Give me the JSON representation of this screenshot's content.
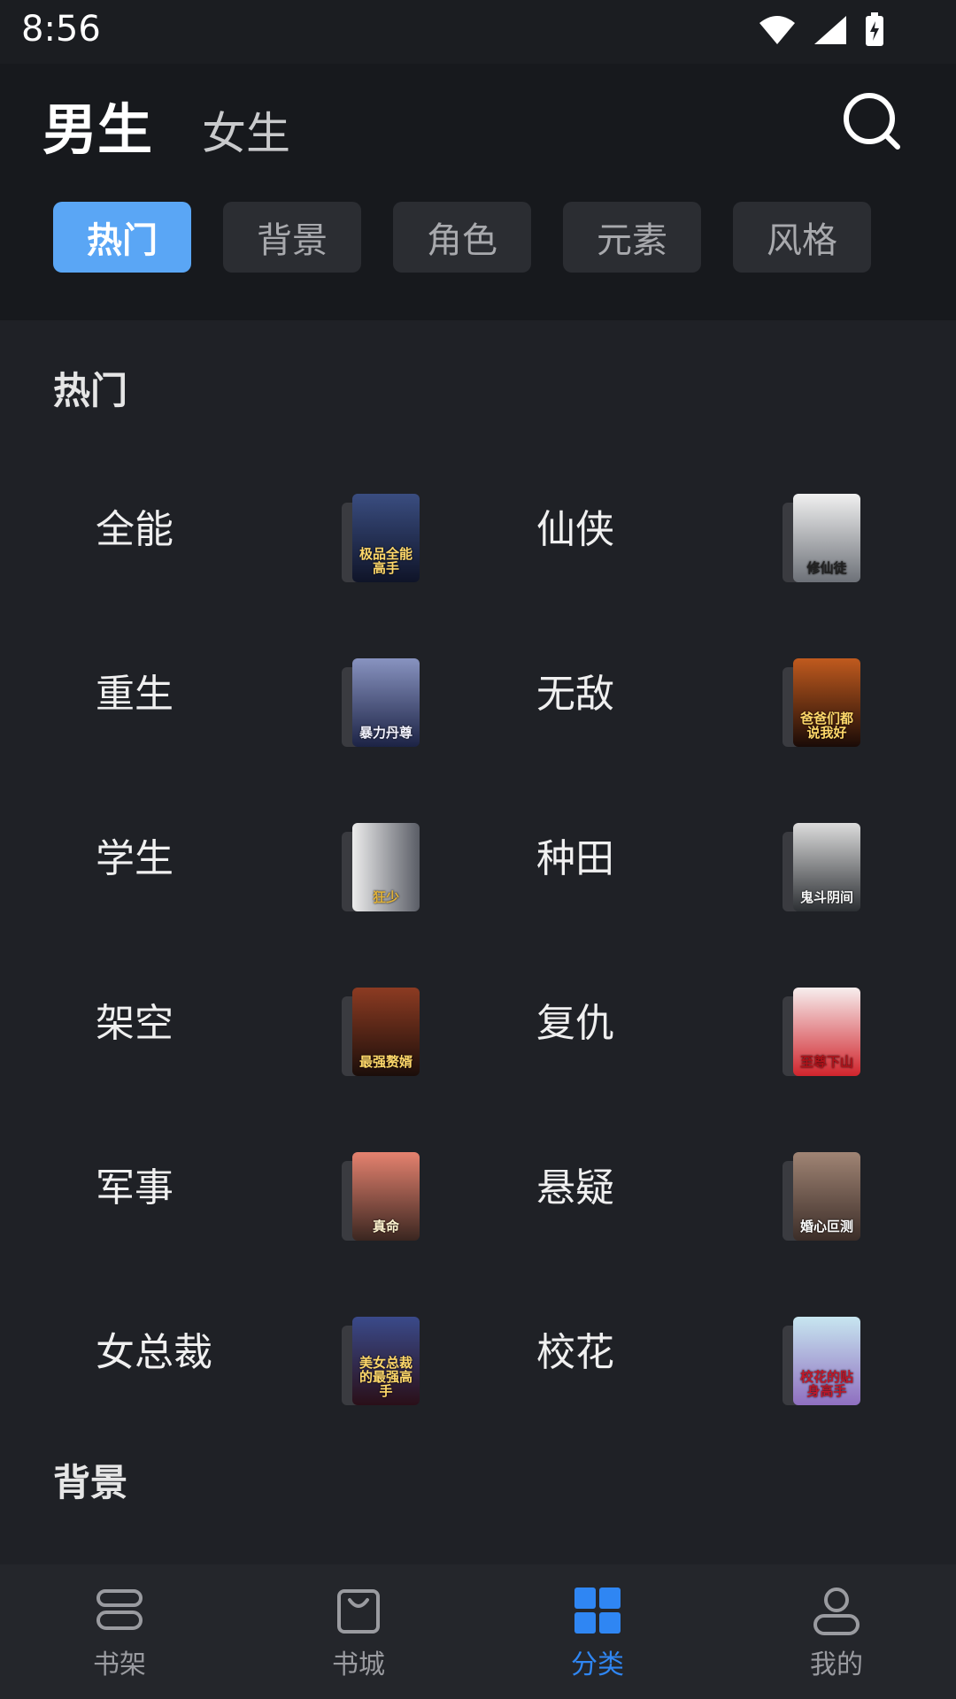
{
  "status": {
    "time": "8:56"
  },
  "header": {
    "gender_active": "男生",
    "gender_inactive": "女生"
  },
  "filters": [
    "热门",
    "背景",
    "角色",
    "元素",
    "风格"
  ],
  "sections": [
    {
      "title": "热门",
      "items": [
        {
          "label": "全能",
          "cover_text": "极品全能高手",
          "cover_color": "#1f2a4a"
        },
        {
          "label": "仙侠",
          "cover_text": "修仙徒",
          "cover_color": "#d8dadd"
        },
        {
          "label": "重生",
          "cover_text": "暴力丹尊",
          "cover_color": "#2c3560"
        },
        {
          "label": "无敌",
          "cover_text": "爸爸们都说我好",
          "cover_color": "#3b1c12"
        },
        {
          "label": "学生",
          "cover_text": "狂少",
          "cover_color": "#c8c9cc"
        },
        {
          "label": "种田",
          "cover_text": "鬼斗阴间",
          "cover_color": "#4a4d4f"
        },
        {
          "label": "架空",
          "cover_text": "最强赘婿",
          "cover_color": "#5a2a1c"
        },
        {
          "label": "复仇",
          "cover_text": "至尊下山",
          "cover_color": "#e8e2e2"
        },
        {
          "label": "军事",
          "cover_text": "真命",
          "cover_color": "#d9786a"
        },
        {
          "label": "悬疑",
          "cover_text": "婚心叵测",
          "cover_color": "#6b5a52"
        },
        {
          "label": "女总裁",
          "cover_text": "美女总裁的最强高手",
          "cover_color": "#3a2436"
        },
        {
          "label": "校花",
          "cover_text": "校花的贴身高手",
          "cover_color": "#9fd0c4"
        }
      ]
    },
    {
      "title": "背景"
    }
  ],
  "nav": [
    {
      "label": "书架",
      "icon": "bookshelf-icon",
      "active": false
    },
    {
      "label": "书城",
      "icon": "bookstore-bag-icon",
      "active": false
    },
    {
      "label": "分类",
      "icon": "category-grid-icon",
      "active": true
    },
    {
      "label": "我的",
      "icon": "profile-icon",
      "active": false
    }
  ],
  "colors": {
    "accent": "#2f86f3",
    "chip_active": "#5aa6f5"
  }
}
